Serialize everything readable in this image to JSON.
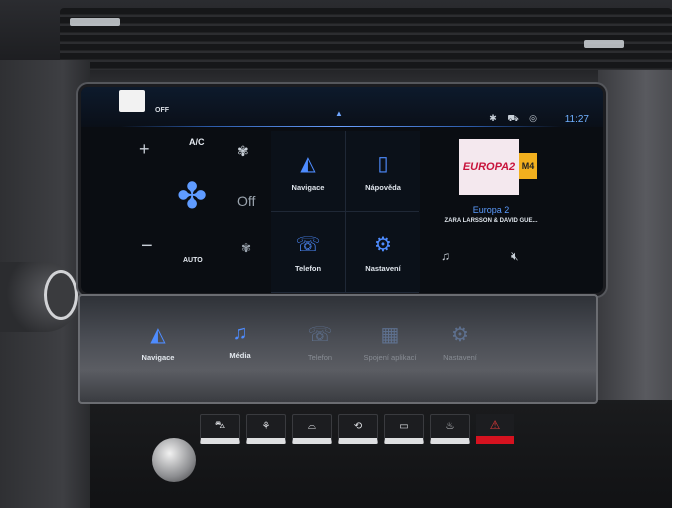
{
  "status": {
    "off": "OFF",
    "icons": "✱ ⛟ ◎",
    "time": "11:27"
  },
  "climate": {
    "plus": "+",
    "minus": "−",
    "ac": "A/C",
    "auto": "AUTO",
    "fan_level": "Off",
    "icons": {
      "fan_small_top": "fan-icon",
      "fan_main": "fan-icon",
      "fan_small_bottom": "fan-icon"
    }
  },
  "tiles": [
    {
      "label": "Navigace",
      "icon": "navigation-arrow-icon"
    },
    {
      "label": "Nápověda",
      "icon": "help-book-icon"
    },
    {
      "label": "Telefon",
      "icon": "phone-icon"
    },
    {
      "label": "Nastavení",
      "icon": "settings-gear-icon"
    }
  ],
  "media": {
    "art_text": "EUROPA2",
    "logo_badge": "M4",
    "station": "Europa 2",
    "artist": "ZARA LARSSON & DAVID GUE...",
    "icons": {
      "source": "music-note-icon",
      "mute": "mute-icon"
    }
  },
  "lower_bar": [
    {
      "label": "Navigace",
      "icon": "navigation-arrow-icon"
    },
    {
      "label": "Média",
      "icon": "music-note-icon"
    },
    {
      "label": "Telefon",
      "icon": "phone-icon"
    },
    {
      "label": "Spojení aplikací",
      "icon": "app-connect-icon"
    },
    {
      "label": "Nastavení",
      "icon": "settings-gear-icon"
    }
  ],
  "colors": {
    "accent": "#4e8cff",
    "hazard": "#d6121f",
    "screen_bg": "#0a0d12"
  }
}
